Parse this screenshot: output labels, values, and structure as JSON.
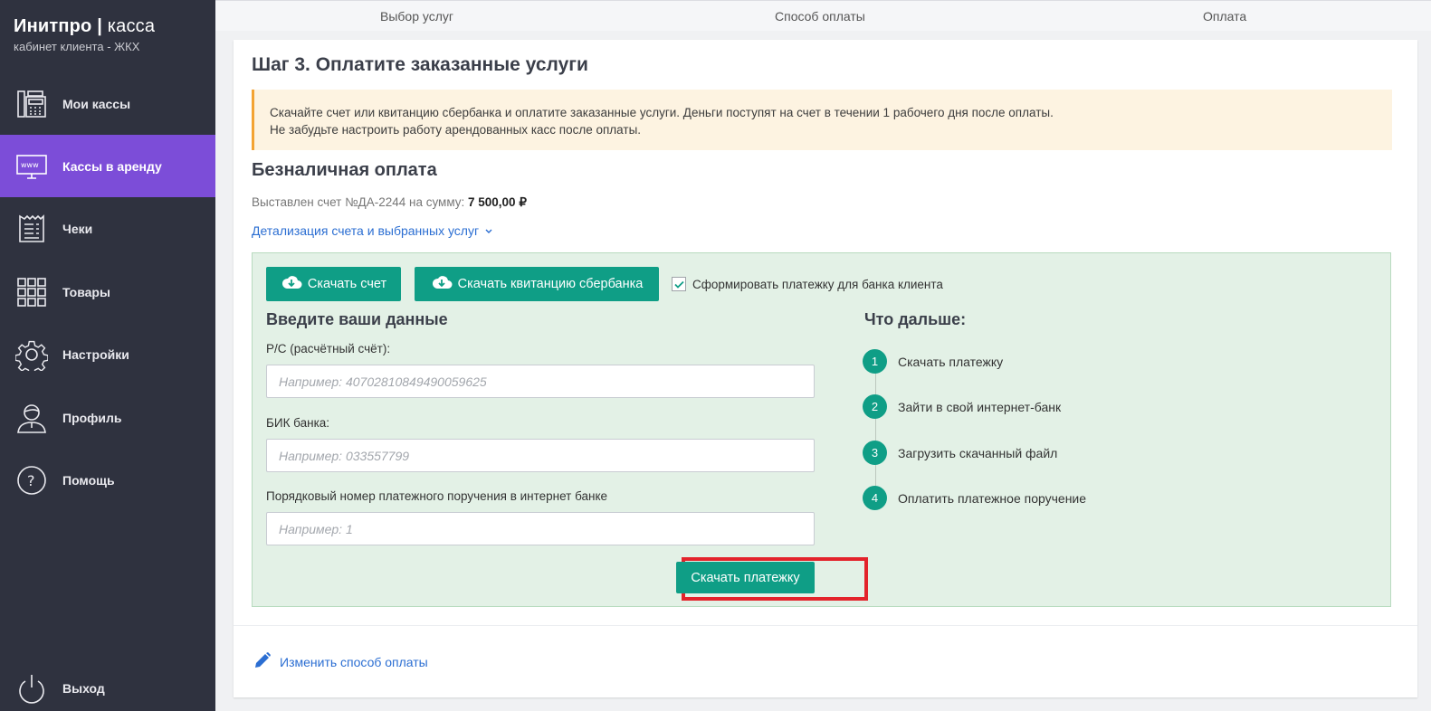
{
  "sidebar": {
    "brand_bold": "Инитпро |",
    "brand_thin": " касса",
    "brand_sub": "кабинет клиента - ЖКХ",
    "items": [
      {
        "label": "Мои кассы",
        "icon": "cash-register-icon"
      },
      {
        "label": "Кассы в аренду",
        "icon": "www-monitor-icon",
        "active": true
      },
      {
        "label": "Чеки",
        "icon": "receipt-icon"
      },
      {
        "label": "Товары",
        "icon": "grid-icon"
      },
      {
        "label": "Настройки",
        "icon": "gear-icon"
      },
      {
        "label": "Профиль",
        "icon": "user-icon"
      },
      {
        "label": "Помощь",
        "icon": "help-icon"
      }
    ],
    "logout": {
      "label": "Выход",
      "icon": "power-icon"
    }
  },
  "steps": [
    "Выбор услуг",
    "Способ оплаты",
    "Оплата"
  ],
  "main": {
    "title": "Шаг 3. Оплатите заказанные услуги",
    "alert_line1": "Скачайте счет или квитанцию сбербанка и оплатите заказанные услуги. Деньги поступят на счет в течении 1 рабочего дня после оплаты.",
    "alert_line2": "Не забудьте настроить работу арендованных касс после оплаты.",
    "section_title": "Безналичная оплата",
    "invoice_text": "Выставлен счет №ДА-2244 на сумму: ",
    "invoice_amount": "7 500,00 ₽",
    "details_link": "Детализация счета и выбранных услуг",
    "btn_download_invoice": "Скачать счет",
    "btn_download_receipt": "Скачать квитанцию сбербанка",
    "checkbox_label": "Сформировать платежку для банка клиента",
    "checkbox_checked": true,
    "form_title": "Введите ваши данные",
    "fields": [
      {
        "label": "Р/С (расчётный счёт):",
        "placeholder": "Например: 40702810849490059625"
      },
      {
        "label": "БИК банка:",
        "placeholder": "Например: 033557799"
      },
      {
        "label": "Порядковый номер платежного поручения в интернет банке",
        "placeholder": "Например: 1"
      }
    ],
    "next_title": "Что дальше:",
    "next_steps": [
      {
        "num": "1",
        "text": "Скачать платежку"
      },
      {
        "num": "2",
        "text": "Зайти в свой интернет-банк"
      },
      {
        "num": "3",
        "text": "Загрузить скачанный файл"
      },
      {
        "num": "4",
        "text": "Оплатить платежное поручение"
      }
    ],
    "btn_download_payment": "Скачать платежку",
    "change_method": "Изменить способ оплаты"
  },
  "colors": {
    "sidebar": "#2f323f",
    "active": "#7c4dd8",
    "accent": "#0f9e86",
    "link": "#2b6ed2",
    "highlight": "#e3232b"
  }
}
